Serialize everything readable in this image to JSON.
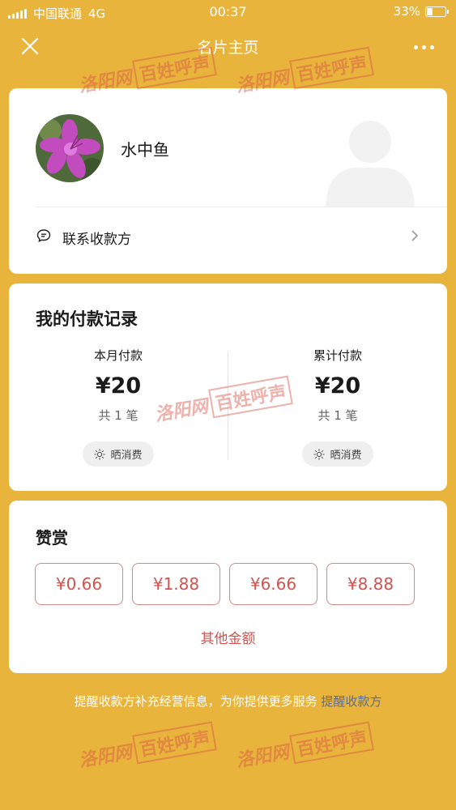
{
  "status_bar": {
    "carrier": "中国联通",
    "network": "4G",
    "time": "00:37",
    "battery": "33%",
    "battery_level": 0.33
  },
  "nav": {
    "title": "名片主页"
  },
  "profile": {
    "name": "水中鱼",
    "contact_label": "联系收款方"
  },
  "records": {
    "heading": "我的付款记录",
    "monthly": {
      "label": "本月付款",
      "amount": "¥20",
      "count": "共 1 笔",
      "share_label": "晒消费"
    },
    "total": {
      "label": "累计付款",
      "amount": "¥20",
      "count": "共 1 笔",
      "share_label": "晒消费"
    }
  },
  "tip": {
    "heading": "赞赏",
    "amounts": [
      "¥0.66",
      "¥1.88",
      "¥6.66",
      "¥8.88"
    ],
    "other_label": "其他金额"
  },
  "footer": {
    "text": "提醒收款方补充经营信息，为你提供更多服务",
    "link": "提醒收款方"
  },
  "watermark": {
    "site": "洛阳网",
    "column": "百姓呼声"
  },
  "colors": {
    "background": "#E9B43C",
    "accent_red": "#D0544F",
    "link_blue": "#5B6D95"
  }
}
